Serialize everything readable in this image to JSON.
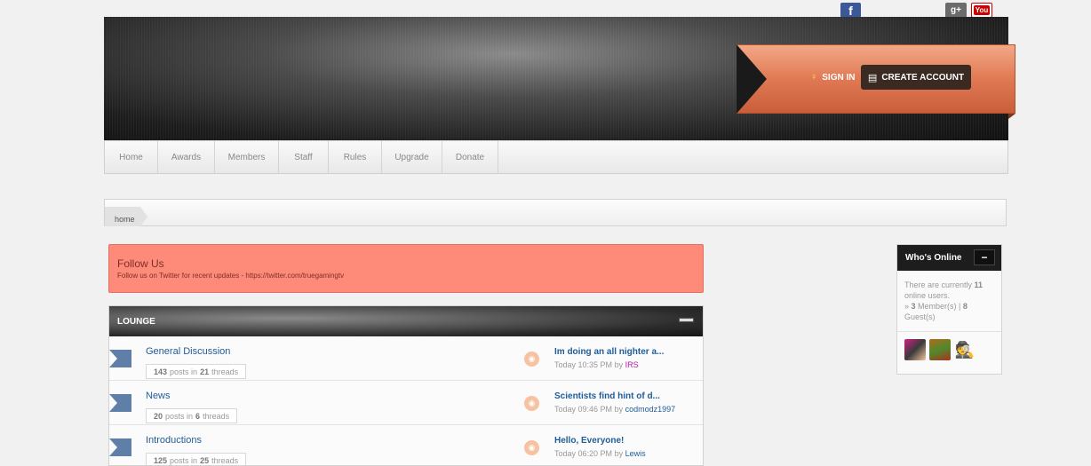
{
  "social": {
    "facebook_glyph": "f",
    "googleplus_glyph": "g+",
    "youtube_glyph": "You"
  },
  "header": {
    "signin_label": "SIGN IN",
    "create_account_label": "CREATE ACCOUNT"
  },
  "nav": {
    "items": [
      "Home",
      "Awards",
      "Members",
      "Staff",
      "Rules",
      "Upgrade",
      "Donate"
    ]
  },
  "breadcrumb": {
    "home_label": "home"
  },
  "notice": {
    "title": "Follow Us",
    "text": "Follow us on Twitter for recent updates - https://twitter.com/truegamingtv"
  },
  "forum": {
    "category": "LOUNGE",
    "rows": [
      {
        "name": "General Discussion",
        "posts": "143",
        "threads": "21",
        "last_title": "Im doing an all nighter a...",
        "last_time": "Today 10:35 PM",
        "last_user": "IRS"
      },
      {
        "name": "News",
        "posts": "20",
        "threads": "6",
        "last_title": "Scientists find hint of d...",
        "last_time": "Today 09:46 PM",
        "last_user": "codmodz1997"
      },
      {
        "name": "Introductions",
        "posts": "125",
        "threads": "25",
        "last_title": "Hello, Everyone!",
        "last_time": "Today 06:20 PM",
        "last_user": "Lewis"
      }
    ],
    "posts_in": "posts in",
    "threads_word": "threads",
    "by_word": "by"
  },
  "who_online": {
    "title": "Who's Online",
    "toggle_glyph": "−",
    "line1_prefix": "There are currently",
    "online_count": "11",
    "line1_suffix": "online users.",
    "members_prefix": "» ",
    "members_count": "3",
    "members_label": "Member(s) |",
    "guests_count": "8",
    "guests_label": "Guest(s)"
  }
}
